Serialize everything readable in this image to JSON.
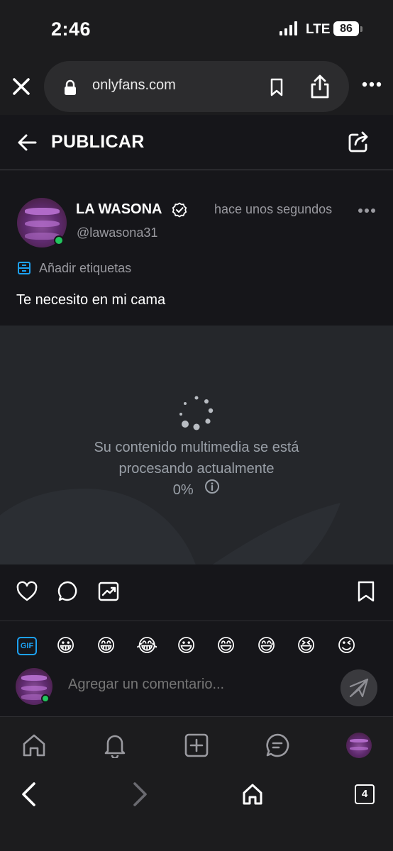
{
  "status_bar": {
    "time": "2:46",
    "network": "LTE",
    "battery": "86"
  },
  "browser": {
    "url": "onlyfans.com",
    "tabs_count": "4"
  },
  "header": {
    "title": "PUBLICAR"
  },
  "post": {
    "author_name": "LA WASONA",
    "handle": "@lawasona31",
    "time_ago": "hace unos segundos",
    "tags_label": "Añadir etiquetas",
    "text": "Te necesito en mi cama",
    "media": {
      "processing_message": "Su contenido multimedia se está procesando actualmente",
      "progress": "0%"
    }
  },
  "comment": {
    "placeholder": "Agregar un comentario...",
    "emojis": [
      "😀",
      "😁",
      "😂",
      "😃",
      "😄",
      "😅",
      "😆",
      "😉"
    ],
    "gif_label": "GIF"
  },
  "colors": {
    "accent": "#1da1f2",
    "online": "#22c55e",
    "background": "#16161a"
  }
}
